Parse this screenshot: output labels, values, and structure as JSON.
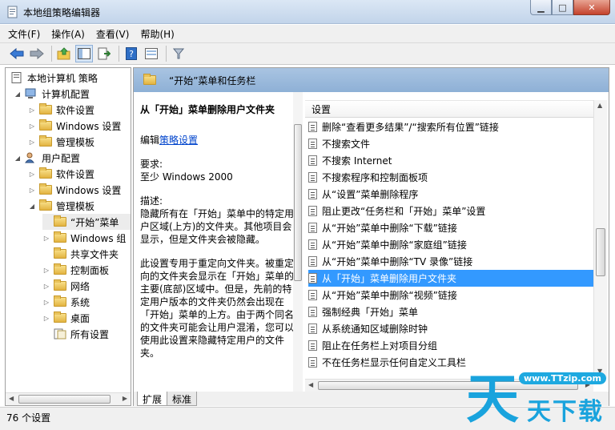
{
  "window": {
    "title": "本地组策略编辑器"
  },
  "menubar": {
    "items": [
      "文件(F)",
      "操作(A)",
      "查看(V)",
      "帮助(H)"
    ]
  },
  "tree": {
    "root": "本地计算机 策略",
    "computer_config": "计算机配置",
    "cc_items": [
      "软件设置",
      "Windows 设置",
      "管理模板"
    ],
    "user_config": "用户配置",
    "uc_items": [
      "软件设置",
      "Windows 设置",
      "管理模板"
    ],
    "admin_items": [
      "“开始”菜单",
      "Windows 组",
      "共享文件夹",
      "控制面板",
      "网络",
      "系统",
      "桌面",
      "所有设置"
    ]
  },
  "header": {
    "title": "“开始”菜单和任务栏"
  },
  "description": {
    "title": "从「开始」菜单删除用户文件夹",
    "edit_prefix": "编辑",
    "edit_link": "策略设置",
    "requirements_label": "要求:",
    "requirements_value": "至少 Windows 2000",
    "description_label": "描述:",
    "description_text": "隐藏所有在「开始」菜单中的特定用户区域(上方)的文件夹。其他项目会显示，但是文件夹会被隐藏。",
    "extra_text": "此设置专用于重定向文件夹。被重定向的文件夹会显示在「开始」菜单的主要(底部)区域中。但是，先前的特定用户版本的文件夹仍然会出现在「开始」菜单的上方。由于两个同名的文件夹可能会让用户混淆，您可以使用此设置来隐藏特定用户的文件夹。"
  },
  "list": {
    "column_header": "设置",
    "rows": [
      "删除“查看更多结果”/“搜索所有位置”链接",
      "不搜索文件",
      "不搜索 Internet",
      "不搜索程序和控制面板项",
      "从“设置”菜单删除程序",
      "阻止更改“任务栏和「开始」菜单”设置",
      "从“开始”菜单中删除“下载”链接",
      "从“开始”菜单中删除“家庭组”链接",
      "从“开始”菜单中删除“TV 录像”链接",
      "从「开始」菜单删除用户文件夹",
      "从“开始”菜单中删除“视频”链接",
      "强制经典「开始」菜单",
      "从系统通知区域删除时钟",
      "阻止在任务栏上对项目分组",
      "不在任务栏显示任何自定义工具栏"
    ],
    "selected_index": 9
  },
  "tabs": [
    "扩展",
    "标准"
  ],
  "status": {
    "text": "76 个设置"
  },
  "watermark": {
    "url": "www.TTzip.com",
    "big": "天",
    "small": "天下载"
  }
}
